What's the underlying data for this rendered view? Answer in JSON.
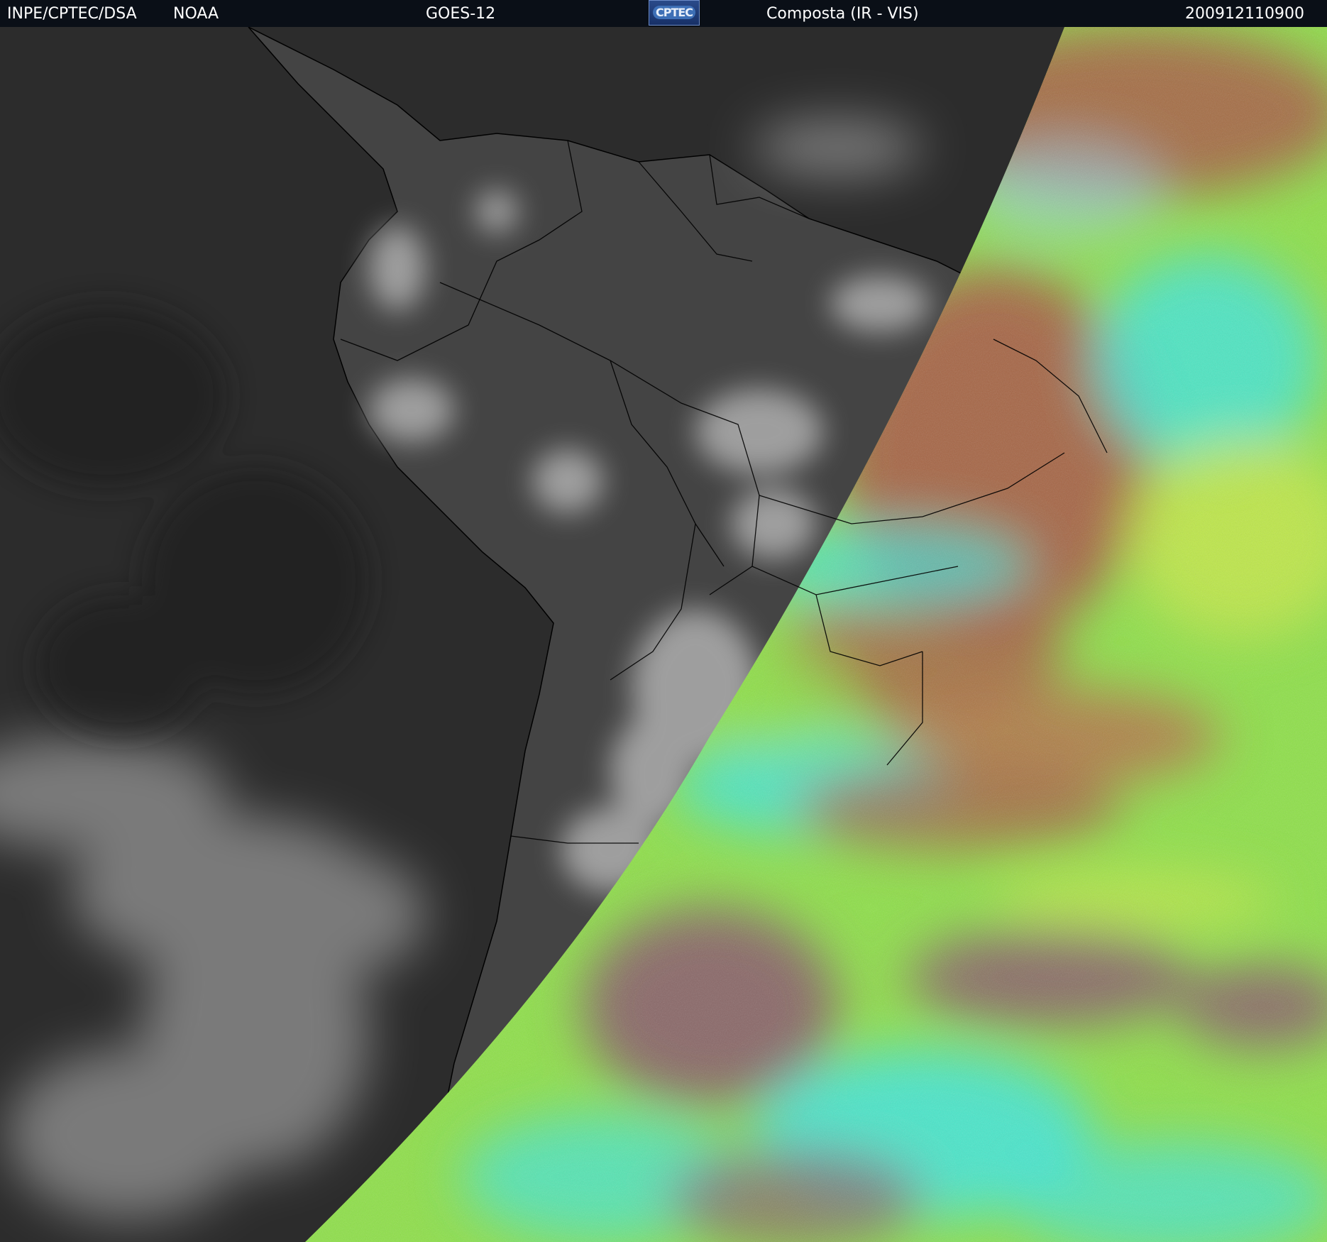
{
  "header": {
    "organization": "INPE/CPTEC/DSA",
    "agency": "NOAA",
    "satellite": "GOES-12",
    "logo_text": "CPTEC",
    "product": "Composta (IR - VIS)",
    "timestamp": "200912110900"
  },
  "colors": {
    "background_dark": "#0a0f17",
    "ir_ocean": "#2d2d2d",
    "ir_land": "#454545",
    "ir_cloud": "#c8c8c8",
    "vis_base": "#8fe04a",
    "vis_cyan": "#3fe6e0",
    "vis_red": "#a95a45",
    "vis_magenta": "#8a5b6c",
    "vis_yellow": "#c9e94a",
    "coastline": "#000000"
  }
}
